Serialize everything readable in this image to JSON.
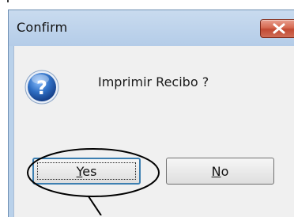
{
  "dialog": {
    "title": "Confirm",
    "message": "Imprimir Recibo ?",
    "icon": "question-icon",
    "close_icon": "close-icon"
  },
  "buttons": {
    "yes": {
      "mnemonic": "Y",
      "rest": "es"
    },
    "no": {
      "mnemonic": "N",
      "rest": "o"
    }
  },
  "colors": {
    "title_bar": "#b9d1ea",
    "client_background": "#f0f0f0",
    "close_button": "#c24a33",
    "question_icon": "#2f6fc4",
    "annotation": "#000000"
  }
}
